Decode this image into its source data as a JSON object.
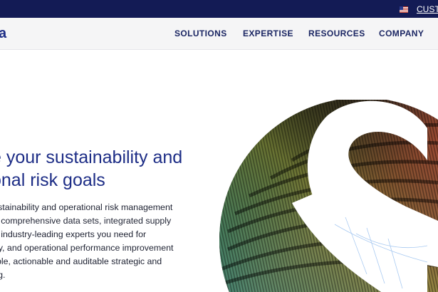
{
  "topbar": {
    "region_flag": "us-flag-icon",
    "customer_link": "CUSTO"
  },
  "header": {
    "logo_fragment": "a",
    "nav": [
      {
        "label": "SOLUTIONS"
      },
      {
        "label": "EXPERTISE"
      },
      {
        "label": "RESOURCES"
      },
      {
        "label": "COMPANY"
      }
    ]
  },
  "hero": {
    "headline_lines": [
      "e your sustainability and",
      "onal risk goals"
    ],
    "body_lines": [
      "sustainability and operational risk management",
      "m, comprehensive data sets, integrated supply",
      "nd industry-leading experts you need for",
      "fety, and operational performance improvement",
      "rable, actionable and auditable strategic and",
      "ting."
    ]
  },
  "colors": {
    "topbar_bg": "#131b55",
    "brand_navy": "#1d2d86",
    "nav_bg": "#f5f5f6"
  }
}
